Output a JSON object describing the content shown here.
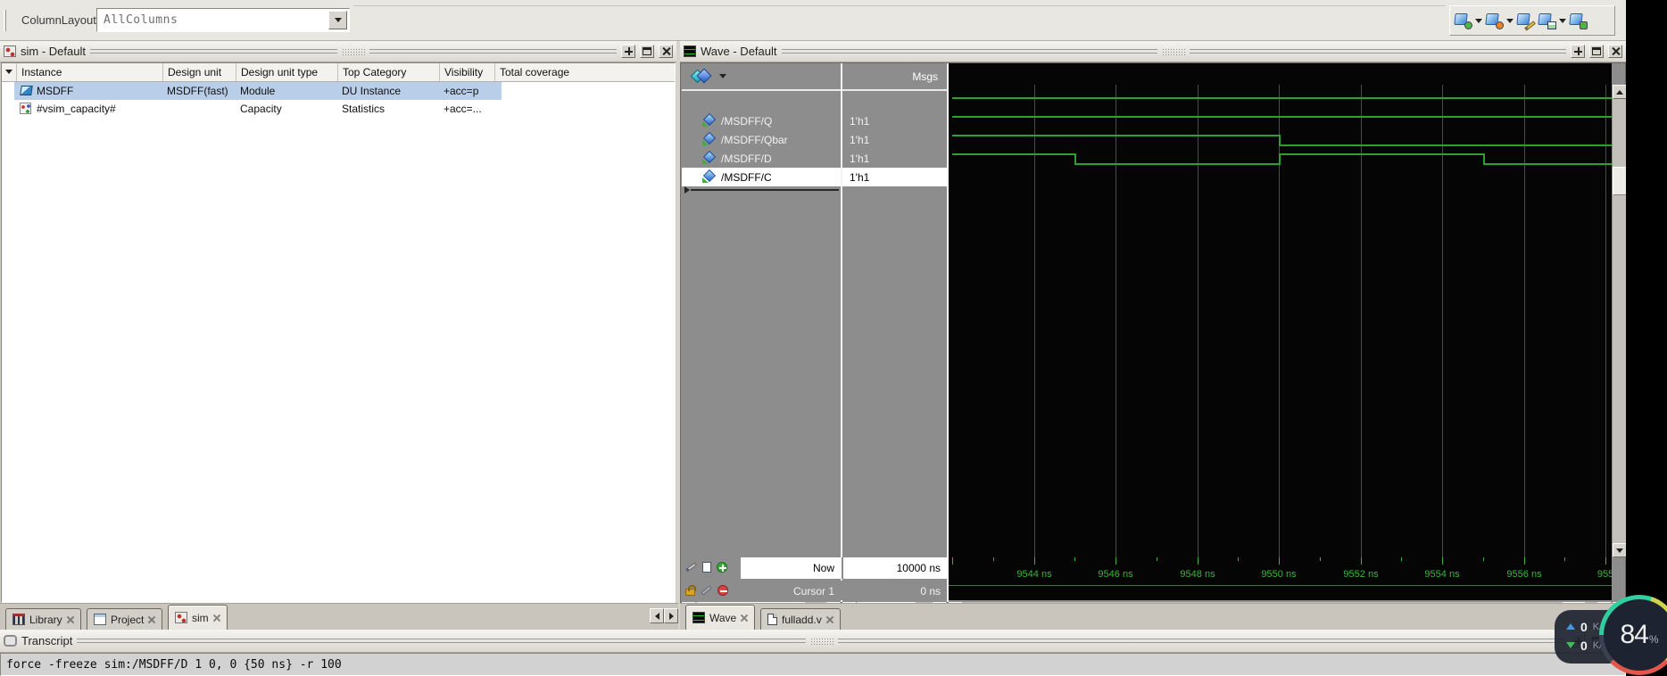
{
  "toolbar": {
    "column_layout_label": "ColumnLayout",
    "column_layout_value": "AllColumns"
  },
  "sim_panel": {
    "title": "sim - Default",
    "columns": [
      "Instance",
      "Design unit",
      "Design unit type",
      "Top Category",
      "Visibility",
      "Total coverage"
    ],
    "rows": [
      {
        "icon": "module",
        "cells": [
          "MSDFF",
          "MSDFF(fast)",
          "Module",
          "DU Instance",
          "+acc=p",
          ""
        ],
        "selected": true
      },
      {
        "icon": "capacity",
        "cells": [
          "#vsim_capacity#",
          "",
          "Capacity",
          "Statistics",
          "+acc=...",
          ""
        ],
        "selected": false
      }
    ]
  },
  "wave_panel": {
    "title": "Wave - Default",
    "msgs_header": "Msgs",
    "signals": [
      {
        "name": "/MSDFF/Q",
        "value": "1'h1",
        "selected": false
      },
      {
        "name": "/MSDFF/Qbar",
        "value": "1'h1",
        "selected": false
      },
      {
        "name": "/MSDFF/D",
        "value": "1'h1",
        "selected": false
      },
      {
        "name": "/MSDFF/C",
        "value": "1'h1",
        "selected": true
      }
    ],
    "now_label": "Now",
    "now_value": "10000 ns",
    "cursor_label": "Cursor 1",
    "cursor_value": "0 ns"
  },
  "chart_data": {
    "type": "line",
    "title": "Wave - Default",
    "x_unit": "ns",
    "x_min": 9542,
    "x_max": 9558.2,
    "major_tick_ns": [
      9544,
      9546,
      9548,
      9550,
      9552,
      9554,
      9556,
      9558
    ],
    "timeline_labels": [
      "9544 ns",
      "9546 ns",
      "9548 ns",
      "9550 ns",
      "9552 ns",
      "9554 ns",
      "9556 ns",
      "955"
    ],
    "series": [
      {
        "name": "/MSDFF/Q",
        "segments": [
          {
            "from": 9542,
            "to": 9558.2,
            "level": 1
          }
        ]
      },
      {
        "name": "/MSDFF/Qbar",
        "segments": [
          {
            "from": 9542,
            "to": 9558.2,
            "level": 1
          }
        ]
      },
      {
        "name": "/MSDFF/D",
        "segments": [
          {
            "from": 9542,
            "to": 9550,
            "level": 1
          },
          {
            "from": 9550,
            "to": 9558.2,
            "level": 0
          }
        ]
      },
      {
        "name": "/MSDFF/C",
        "segments": [
          {
            "from": 9542,
            "to": 9545,
            "level": 1
          },
          {
            "from": 9545,
            "to": 9550,
            "level": 0
          },
          {
            "from": 9550,
            "to": 9555,
            "level": 1
          },
          {
            "from": 9555,
            "to": 9558.2,
            "level": 0
          }
        ]
      }
    ]
  },
  "tabs": {
    "left": [
      {
        "id": "library",
        "label": "Library",
        "active": false
      },
      {
        "id": "project",
        "label": "Project",
        "active": false
      },
      {
        "id": "sim",
        "label": "sim",
        "active": true
      }
    ],
    "right": [
      {
        "id": "wave",
        "label": "Wave",
        "active": true
      },
      {
        "id": "fulladd",
        "label": "fulladd.v",
        "active": false
      }
    ]
  },
  "transcript": {
    "title": "Transcript",
    "line": "force -freeze sim:/MSDFF/D 1 0, 0 {50 ns} -r 100"
  },
  "overlay": {
    "upload_value": "0",
    "upload_unit": "K/s",
    "download_value": "0",
    "download_unit": "K/s",
    "percent": "84",
    "percent_sign": "%"
  },
  "colors": {
    "trace": "#2da02d",
    "timeline_text": "#3cb43c",
    "selection": "#b9cee8",
    "panel_gray": "#8d8d8d"
  }
}
